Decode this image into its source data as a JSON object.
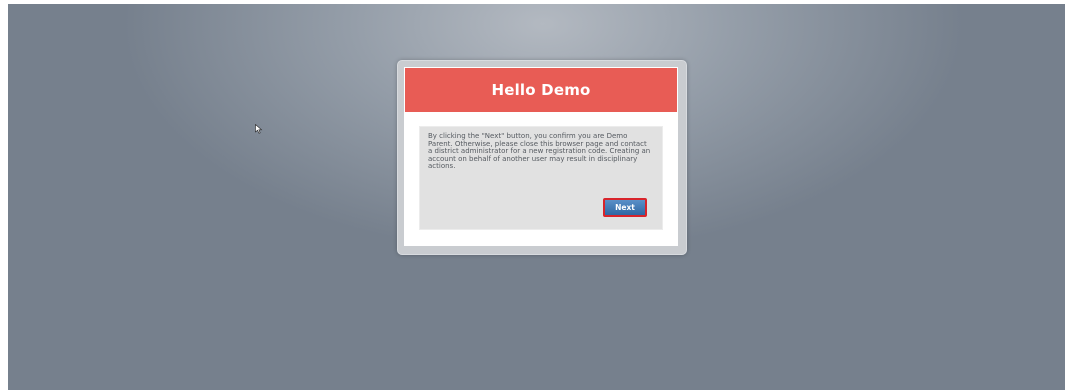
{
  "dialog": {
    "title": "Hello Demo",
    "message": "By clicking the \"Next\" button, you confirm you are Demo Parent. Otherwise, please close this browser page and contact a district administrator for a new registration code. Creating an account on behalf of another user may result in disciplinary actions.",
    "next_label": "Next"
  },
  "colors": {
    "header": "#e85c55",
    "button": "#3a74b1",
    "button_border": "#d8242b",
    "background": "#75808c"
  },
  "icons": {
    "pointer": "mouse-pointer-icon"
  }
}
